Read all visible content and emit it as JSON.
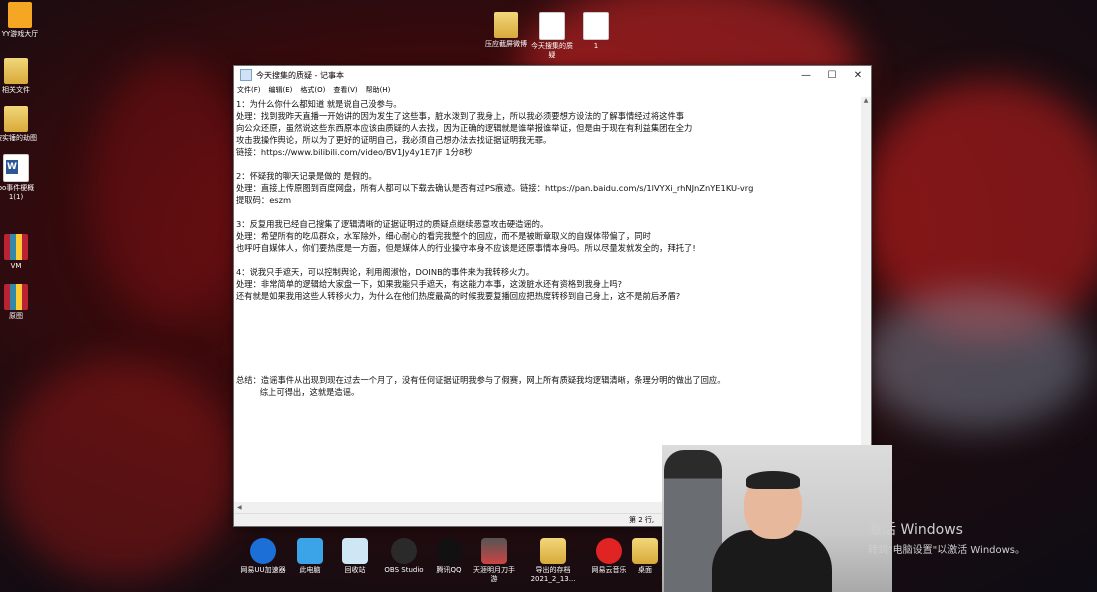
{
  "desktop": {
    "left_icons": [
      {
        "label": "YY游戏大厅",
        "icon": "game-icon"
      },
      {
        "label": "相关文件",
        "icon": "folder-icon"
      },
      {
        "label": "被实锤的劫图",
        "icon": "folder-icon"
      },
      {
        "label": "oo事件梗概1(1)",
        "icon": "word-doc-icon"
      },
      {
        "label": "VM",
        "icon": "rar-icon"
      },
      {
        "label": "原图",
        "icon": "rar-icon"
      }
    ],
    "top_icons": [
      {
        "label": "压应截屏微博",
        "icon": "folder-icon"
      },
      {
        "label": "今天搜集的质疑",
        "icon": "text-doc-icon"
      },
      {
        "label": "1",
        "icon": "text-doc-icon"
      }
    ]
  },
  "notepad": {
    "title": "今天搜集的质疑 - 记事本",
    "menu": [
      "文件(F)",
      "编辑(E)",
      "格式(O)",
      "查看(V)",
      "帮助(H)"
    ],
    "lines": [
      "1：为什么你什么都知道 就是说自己没参与。",
      "处理：找到我昨天直播一开始讲的因为发生了这些事，脏水泼到了我身上，所以我必须要想方设法的了解事情经过将这件事",
      "向公众还原，虽然说这些东西原本应该由质疑的人去找，因为正确的逻辑就是谁举报谁举证，但是由于现在有利益集团在全力",
      "攻击我操作舆论，所以为了更好的证明自己，我必须自己想办法去找证据证明我无罪。",
      "链接：https://www.bilibili.com/video/BV1Jy4y1E7jF 1分8秒",
      "",
      "2：怀疑我的聊天记录是做的 是假的。",
      "处理：直接上传原图到百度网盘，所有人都可以下载去确认是否有过PS痕迹。链接：https://pan.baidu.com/s/1lVYXi_rhNJnZnYE1KU-vrg",
      "提取码：eszm",
      "",
      "3：反复用我已经自己搜集了逻辑清晰的证据证明过的质疑点继续恶意攻击硬造谣的。",
      "处理：希望所有的吃瓜群众，水军除外，细心耐心的看完我整个的回应，而不是被断章取义的自媒体带偏了，同时",
      "也呼吁自媒体人，你们要热度是一方面，但是媒体人的行业操守本身不应该是还原事情本身吗。所以尽量发就发全的，拜托了!",
      "",
      "4：说我只手遮天，可以控制舆论，利用阁淑怡，DOINB的事件来为我转移火力。",
      "处理：非常简单的逻辑给大家盘一下，如果我能只手遮天，有这能力本事，这泼脏水还有资格到我身上吗?",
      "还有就是如果我用这些人转移火力，为什么在他们热度最高的时候我要复播回应把热度转移到自己身上，这不是前后矛盾?",
      "",
      "",
      "",
      "",
      "",
      "",
      "总结：造谣事件从出现到现在过去一个月了，没有任何证据证明我参与了假赛，网上所有质疑我均逻辑清晰，条理分明的做出了回应。",
      "         综上可得出，这就是造谣。"
    ],
    "status_position": "第 2 行,"
  },
  "taskbar_apps": [
    {
      "label": "网易UU加速器",
      "icon": "uu-accelerator-icon"
    },
    {
      "label": "此电脑",
      "icon": "computer-icon"
    },
    {
      "label": "回收站",
      "icon": "recycle-bin-icon"
    },
    {
      "label": "OBS Studio",
      "icon": "obs-icon"
    },
    {
      "label": "腾讯QQ",
      "icon": "qq-icon"
    },
    {
      "label": "天涯明月刀手游",
      "icon": "game-icon"
    },
    {
      "label": "导出的存档2021_2_13...",
      "icon": "folder-icon"
    },
    {
      "label": "网易云音乐",
      "icon": "netease-music-icon"
    },
    {
      "label": "桌面",
      "icon": "folder-icon"
    }
  ],
  "watermark": {
    "line1": "激活 Windows",
    "line2": "转到\"电脑设置\"以激活 Windows。"
  }
}
